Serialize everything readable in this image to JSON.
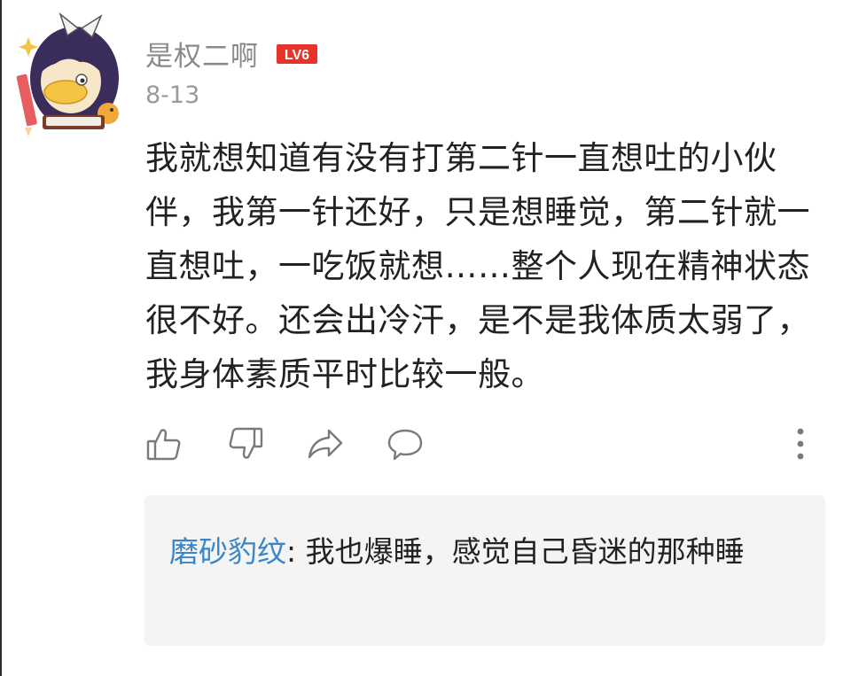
{
  "comment": {
    "username": "是权二啊",
    "level_badge": "LV6",
    "timestamp": "8-13",
    "body": "我就想知道有没有打第二针一直想吐的小伙伴，我第一针还好，只是想睡觉，第二针就一直想吐，一吃饭就想……整个人现在精神状态很不好。还会出冷汗，是不是我体质太弱了，我身体素质平时比较一般。",
    "avatar_icon": "anime-girl-avatar-icon"
  },
  "actions": {
    "like_icon": "thumbs-up-icon",
    "dislike_icon": "thumbs-down-icon",
    "share_icon": "share-arrow-icon",
    "reply_icon": "speech-bubble-icon",
    "more_icon": "more-vertical-icon"
  },
  "reply": {
    "author": "磨砂豹纹",
    "separator": ": ",
    "text": "我也爆睡，感觉自己昏迷的那种睡"
  },
  "colors": {
    "badge_red": "#e8332b",
    "reply_author_blue": "#3d86c6",
    "reply_bg": "#f4f4f4",
    "icon_gray": "#7a7a7a"
  }
}
